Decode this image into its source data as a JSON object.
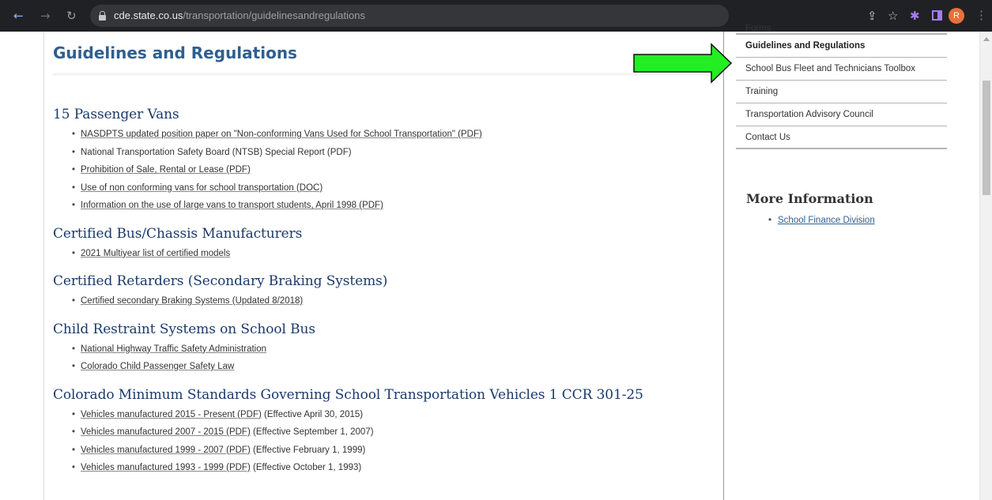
{
  "browser": {
    "url_host": "cde.state.co.us",
    "url_path": "/transportation/guidelinesandregulations",
    "profile_initial": "R",
    "icons": [
      "back-icon",
      "forward-icon",
      "reload-icon",
      "lock-icon",
      "share-icon",
      "bookmark-star-icon",
      "extensions-icon",
      "side-panel-icon",
      "menu-icon"
    ],
    "colors": {
      "toolbar": "#202124",
      "omnibox": "#35363a",
      "avatar": "#e8703a",
      "extension": "#a47cf0"
    }
  },
  "page": {
    "title": "Guidelines and Regulations",
    "colors": {
      "title": "#2f5f8f",
      "section_heading": "#1b3a6b",
      "arrow_fill": "#22ee22"
    }
  },
  "sections": [
    {
      "heading": "15 Passenger Vans",
      "items": [
        {
          "link": "NASDPTS updated position paper on \"Non-conforming Vans Used for School Transportation\" (PDF)",
          "note": ""
        },
        {
          "link": "",
          "note": "National Transportation Safety Board (NTSB) Special Report (PDF)"
        },
        {
          "link": "Prohibition of Sale, Rental or Lease (PDF)",
          "note": ""
        },
        {
          "link": "Use of non conforming vans for school transportation (DOC)",
          "note": ""
        },
        {
          "link": "Information on the use of large vans to transport students, April 1998 (PDF)",
          "note": ""
        }
      ]
    },
    {
      "heading": "Certified Bus/Chassis Manufacturers",
      "items": [
        {
          "link": "2021 Multiyear list of certified models",
          "note": ""
        }
      ]
    },
    {
      "heading": "Certified Retarders (Secondary Braking Systems)",
      "items": [
        {
          "link": "Certified secondary Braking Systems (Updated 8/2018)",
          "note": ""
        }
      ]
    },
    {
      "heading": "Child Restraint Systems on School Bus",
      "items": [
        {
          "link": "National Highway Traffic Safety Administration",
          "note": ""
        },
        {
          "link": "Colorado Child Passenger Safety Law",
          "note": ""
        }
      ]
    },
    {
      "heading": "Colorado Minimum Standards Governing School Transportation Vehicles 1 CCR 301-25",
      "items": [
        {
          "link": "Vehicles manufactured 2015 - Present (PDF)",
          "note": " (Effective April 30, 2015)"
        },
        {
          "link": "Vehicles manufactured 2007 - 2015 (PDF)",
          "note": " (Effective September 1, 2007)"
        },
        {
          "link": "Vehicles manufactured 1999 - 2007 (PDF)",
          "note": " (Effective February 1, 1999)"
        },
        {
          "link": "Vehicles manufactured 1993 - 1999 (PDF)",
          "note": " (Effective October 1, 1993)"
        }
      ]
    }
  ],
  "sidebar": {
    "items": [
      {
        "label": "Forms",
        "active": false
      },
      {
        "label": "Guidelines and Regulations",
        "active": true
      },
      {
        "label": "School Bus Fleet and Technicians Toolbox",
        "active": false
      },
      {
        "label": "Training",
        "active": false
      },
      {
        "label": "Transportation Advisory Council",
        "active": false
      },
      {
        "label": "Contact Us",
        "active": false
      }
    ],
    "more_info": {
      "heading": "More Information",
      "links": [
        "School Finance Division"
      ]
    }
  }
}
